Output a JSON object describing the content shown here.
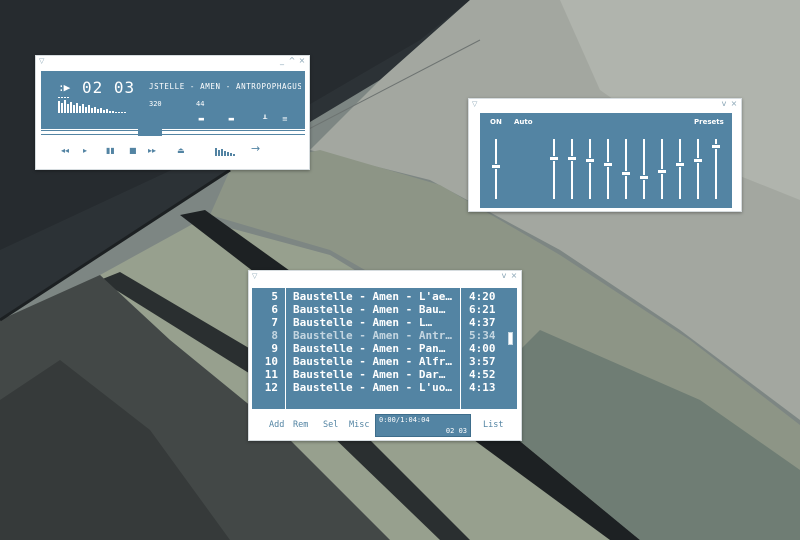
{
  "colors": {
    "accent": "#5384a3",
    "window_bg": "#ffffff",
    "text_on_accent": "#ffffff"
  },
  "player": {
    "titlebar_icons": [
      "menu-icon",
      "minimize-icon",
      "shade-icon",
      "close-icon"
    ],
    "play_indicator": ":▶",
    "time": "02 03",
    "song_marquee": "JSTELLE - AMEN - ANTROPOPHAGUS",
    "bitrate": "320",
    "samplerate": "44",
    "controls": [
      "previous-icon",
      "play-icon",
      "pause-icon",
      "stop-icon",
      "next-icon",
      "eject-icon",
      "equalizer-icon",
      "playlist-arrow-icon"
    ]
  },
  "equalizer": {
    "on_label": "ON",
    "auto_label": "Auto",
    "presets_label": "Presets",
    "preamp_level": 0.55,
    "band_levels": [
      0.7,
      0.7,
      0.65,
      0.58,
      0.42,
      0.35,
      0.45,
      0.58,
      0.65,
      0.9
    ]
  },
  "playlist": {
    "rows": [
      {
        "num": "5",
        "title": "Baustelle - Amen - L'ae…",
        "duration": "4:20",
        "dim": false
      },
      {
        "num": "6",
        "title": "Baustelle - Amen - Bau…",
        "duration": "6:21",
        "dim": false
      },
      {
        "num": "7",
        "title": "Baustelle - Amen - L…",
        "duration": "4:37",
        "dim": false
      },
      {
        "num": "8",
        "title": "Baustelle - Amen - Antr…",
        "duration": "5:34",
        "dim": true
      },
      {
        "num": "9",
        "title": "Baustelle - Amen - Pan…",
        "duration": "4:00",
        "dim": false
      },
      {
        "num": "10",
        "title": "Baustelle - Amen - Alfr…",
        "duration": "3:57",
        "dim": false
      },
      {
        "num": "11",
        "title": "Baustelle - Amen - Dar…",
        "duration": "4:52",
        "dim": false
      },
      {
        "num": "12",
        "title": "Baustelle - Amen - L'uo…",
        "duration": "4:13",
        "dim": false
      }
    ],
    "buttons": {
      "add": "Add",
      "rem": "Rem",
      "sel": "Sel",
      "misc": "Misc",
      "list": "List"
    },
    "total_time": "0:00/1:04:04",
    "current_time": "02 03"
  }
}
